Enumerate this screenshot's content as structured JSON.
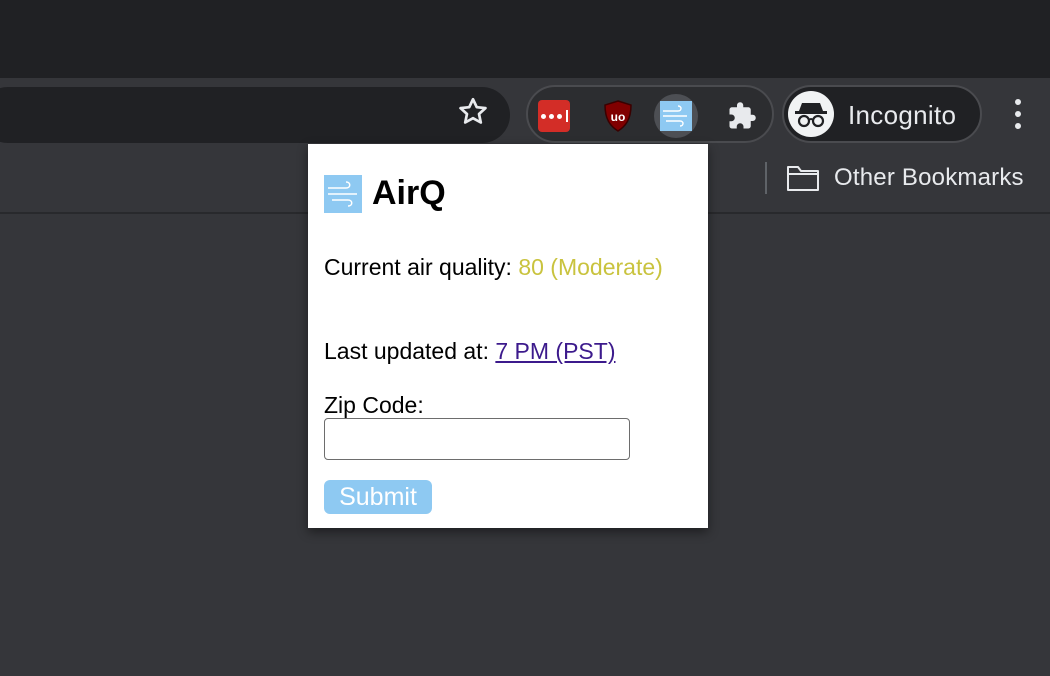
{
  "browser": {
    "profile_label": "Incognito",
    "bookmarks": {
      "other_label": "Other Bookmarks"
    },
    "icons": {
      "star": "bookmark-star-icon",
      "lastpass": "lastpass-icon",
      "ublock": "ublock-origin-icon",
      "airq": "airq-icon",
      "extensions": "puzzle-piece-icon",
      "incognito": "incognito-icon",
      "menu": "kebab-menu-icon",
      "folder": "folder-icon"
    }
  },
  "popup": {
    "title": "AirQ",
    "aq_label": "Current air quality:",
    "aq_value": "80",
    "aq_category": "(Moderate)",
    "updated_label": "Last updated at:",
    "updated_time": "7 PM (PST)",
    "zip_label": "Zip Code:",
    "zip_value": "",
    "submit_label": "Submit"
  },
  "colors": {
    "aq_moderate": "#c9c33e",
    "submit_bg": "#8ec9f2",
    "link": "#3c1a8c",
    "lastpass": "#d32d27",
    "ublock": "#800000"
  }
}
